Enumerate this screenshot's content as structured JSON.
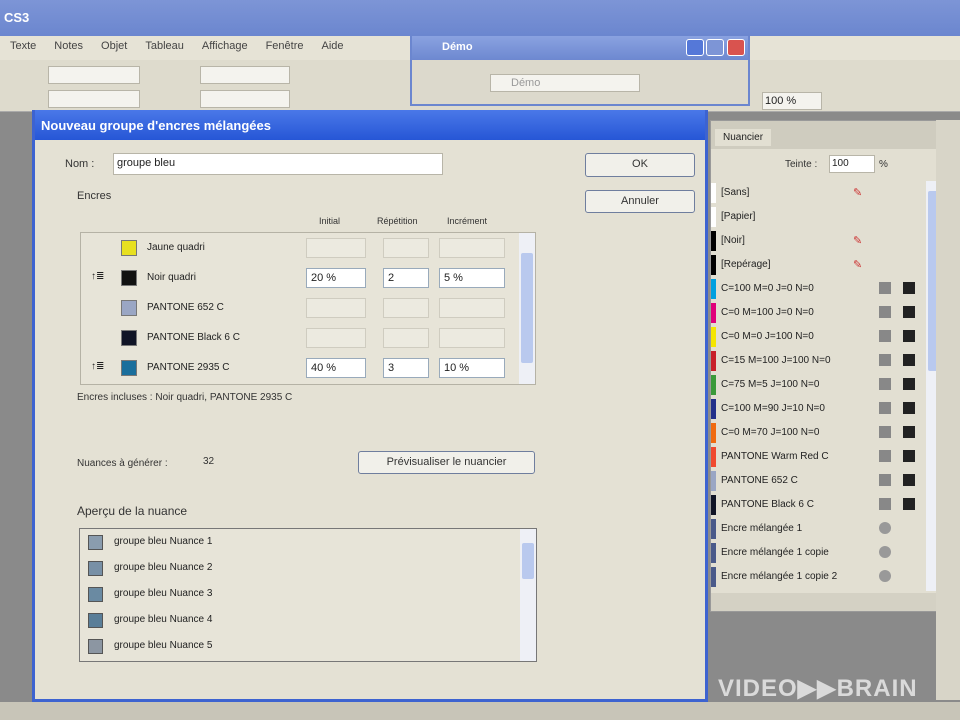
{
  "app": {
    "title": "CS3",
    "menu": [
      "Texte",
      "Notes",
      "Objet",
      "Tableau",
      "Affichage",
      "Fenêtre",
      "Aide"
    ],
    "zoom": "100 %"
  },
  "mini_window": {
    "title": "Démo",
    "path": "Démo"
  },
  "dialog": {
    "title": "Nouveau groupe d'encres mélangées",
    "name_label": "Nom :",
    "name_value": "groupe bleu",
    "ok": "OK",
    "cancel": "Annuler",
    "inks_label": "Encres",
    "columns": [
      "Initial",
      "Répétition",
      "Incrément"
    ],
    "inks": [
      {
        "name": "Jaune quadri",
        "color": "#e8e020",
        "checked": false,
        "initial": "",
        "repeat": "",
        "increment": ""
      },
      {
        "name": "Noir quadri",
        "color": "#111111",
        "checked": true,
        "initial": "20 %",
        "repeat": "2",
        "increment": "5 %"
      },
      {
        "name": "PANTONE 652 C",
        "color": "#9aa6c4",
        "checked": false,
        "initial": "",
        "repeat": "",
        "increment": ""
      },
      {
        "name": "PANTONE Black 6 C",
        "color": "#101426",
        "checked": false,
        "initial": "",
        "repeat": "",
        "increment": ""
      },
      {
        "name": "PANTONE 2935 C",
        "color": "#1a6e9c",
        "checked": true,
        "initial": "40 %",
        "repeat": "3",
        "increment": "10 %"
      }
    ],
    "included": "Encres incluses : Noir quadri, PANTONE 2935 C",
    "to_generate_label": "Nuances à générer :",
    "to_generate_value": "32",
    "preview_button": "Prévisualiser le nuancier",
    "preview_label": "Aperçu de la nuance",
    "preview_items": [
      {
        "name": "groupe bleu Nuance 1",
        "color": "#8a9cae"
      },
      {
        "name": "groupe bleu Nuance 2",
        "color": "#7890a6"
      },
      {
        "name": "groupe bleu Nuance 3",
        "color": "#6a8aa2"
      },
      {
        "name": "groupe bleu Nuance 4",
        "color": "#5a7e98"
      },
      {
        "name": "groupe bleu Nuance 5",
        "color": "#8c96a2"
      }
    ]
  },
  "swatches": {
    "tab": "Nuancier",
    "tint_label": "Teinte :",
    "tint_value": "100",
    "tint_unit": "%",
    "items": [
      {
        "name": "[Sans]",
        "color": "#ffffff"
      },
      {
        "name": "[Papier]",
        "color": "#ffffff"
      },
      {
        "name": "[Noir]",
        "color": "#000000"
      },
      {
        "name": "[Repérage]",
        "color": "#000000"
      },
      {
        "name": "C=100 M=0 J=0 N=0",
        "color": "#00a0e0"
      },
      {
        "name": "C=0 M=100 J=0 N=0",
        "color": "#e0007a"
      },
      {
        "name": "C=0 M=0 J=100 N=0",
        "color": "#f5e600"
      },
      {
        "name": "C=15 M=100 J=100 N=0",
        "color": "#c8202a"
      },
      {
        "name": "C=75 M=5 J=100 N=0",
        "color": "#3a9a3a"
      },
      {
        "name": "C=100 M=90 J=10 N=0",
        "color": "#23308a"
      },
      {
        "name": "C=0 M=70 J=100 N=0",
        "color": "#f06a10"
      },
      {
        "name": "PANTONE Warm Red C",
        "color": "#f04a30"
      },
      {
        "name": "PANTONE 652 C",
        "color": "#9aa6c4"
      },
      {
        "name": "PANTONE Black 6 C",
        "color": "#101426"
      },
      {
        "name": "Encre mélangée 1",
        "color": "#4a5a8a"
      },
      {
        "name": "Encre mélangée 1 copie",
        "color": "#4a5a8a"
      },
      {
        "name": "Encre mélangée 1 copie 2",
        "color": "#4a5a8a"
      }
    ]
  },
  "watermark": "VIDEO▶▶BRAIN"
}
